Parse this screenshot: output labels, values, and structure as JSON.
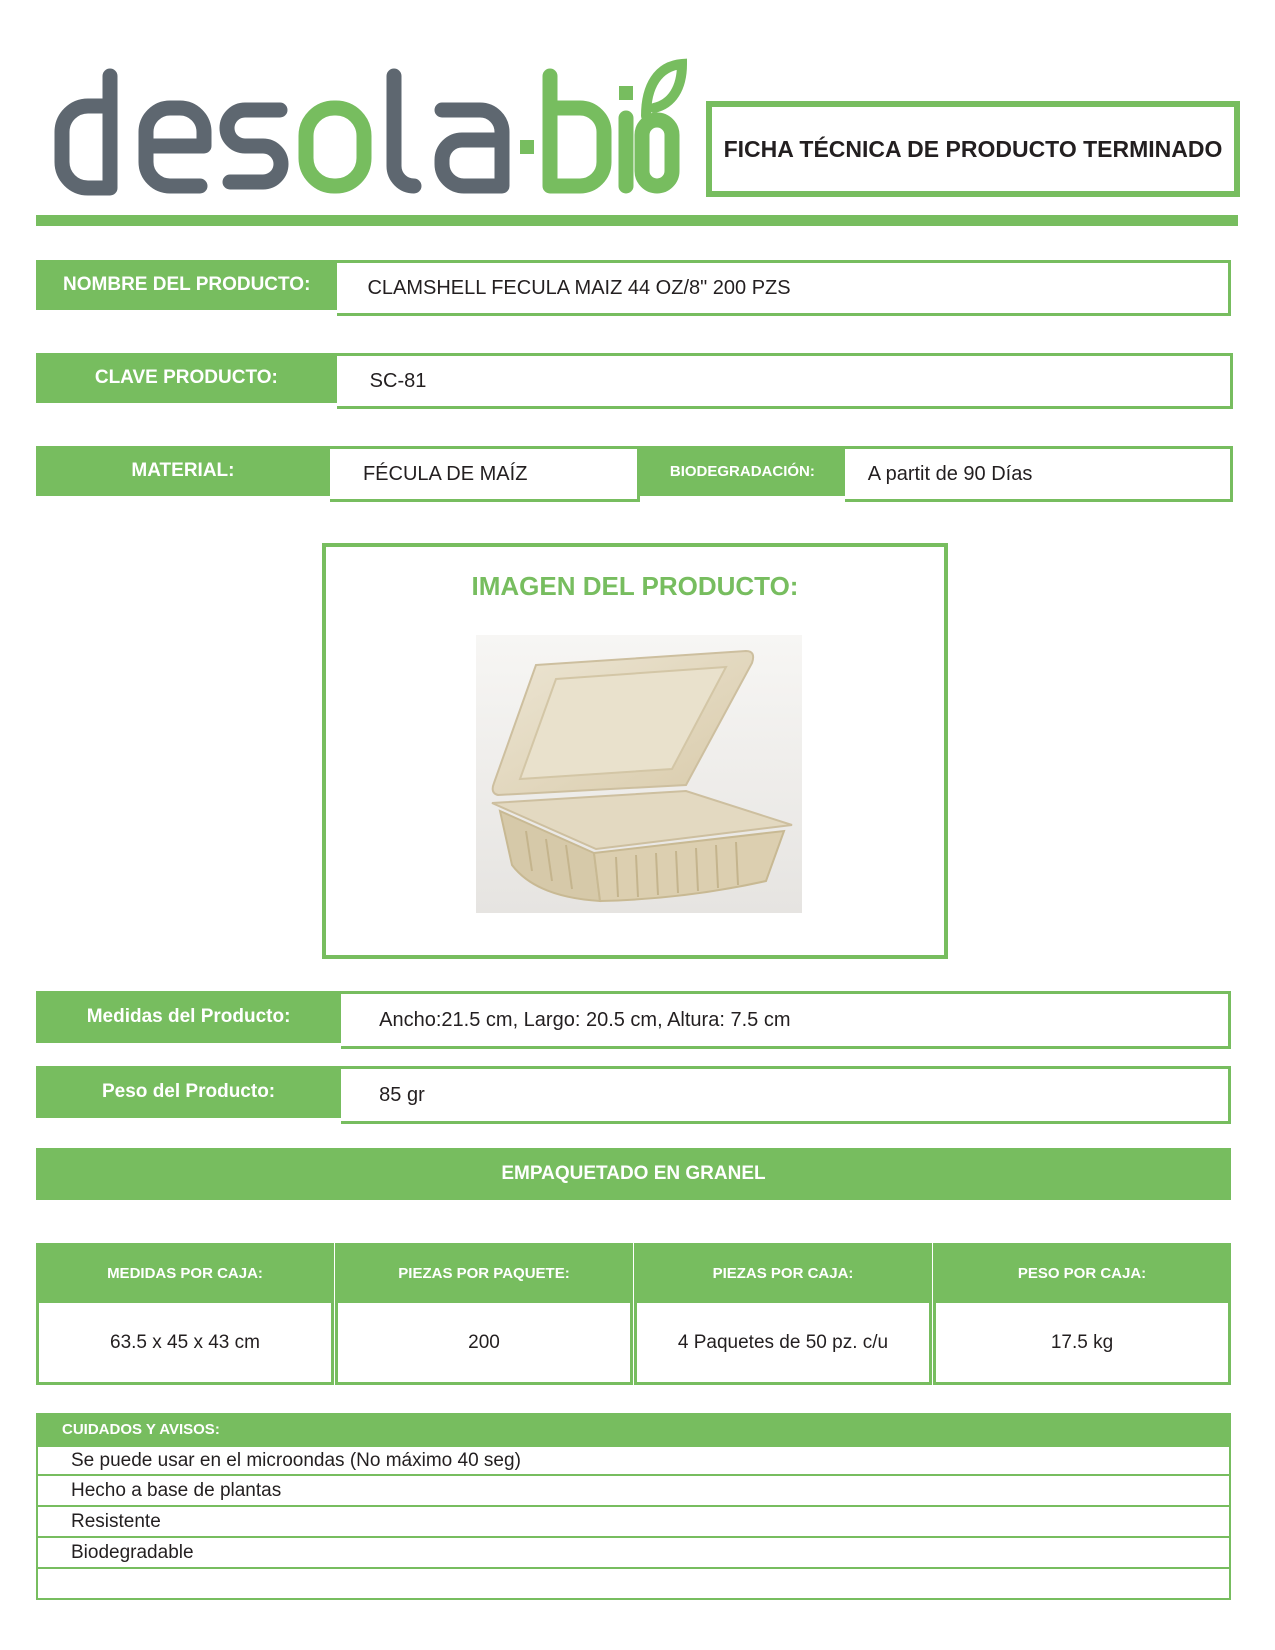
{
  "brand": {
    "name": "desola·bio",
    "gray": "#5e6770",
    "green": "#77bd5f"
  },
  "header": {
    "title": "FICHA TÉCNICA DE PRODUCTO TERMINADO"
  },
  "fields": {
    "product_name_label": "NOMBRE DEL PRODUCTO:",
    "product_name_value": "CLAMSHELL FECULA MAIZ 44 OZ/8\"  200 PZS",
    "code_label": "CLAVE PRODUCTO:",
    "code_value": "SC-81",
    "material_label": "MATERIAL:",
    "material_value": "FÉCULA DE MAÍZ",
    "biodeg_label": "BIODEGRADACIÓN:",
    "biodeg_value": "A partit de 90 Días",
    "dimensions_label": "Medidas del Producto:",
    "dimensions_value": "Ancho:21.5 cm, Largo: 20.5 cm, Altura: 7.5 cm",
    "weight_label": "Peso del Producto:",
    "weight_value": "85 gr"
  },
  "image_section": {
    "title": "IMAGEN DEL PRODUCTO:",
    "photo_icon": "clamshell-container-photo"
  },
  "packaging": {
    "title": "EMPAQUETADO EN GRANEL",
    "headers": [
      "MEDIDAS POR CAJA:",
      "PIEZAS POR PAQUETE:",
      "PIEZAS POR CAJA:",
      "PESO POR CAJA:"
    ],
    "values": [
      "63.5 x 45 x 43 cm",
      "200",
      "4 Paquetes de 50 pz. c/u",
      "17.5 kg"
    ]
  },
  "care": {
    "title": "CUIDADOS Y AVISOS:",
    "items": [
      "Se puede usar en el microondas (No máximo 40 seg)",
      "Hecho a base de plantas",
      "Resistente",
      "Biodegradable",
      ""
    ]
  }
}
